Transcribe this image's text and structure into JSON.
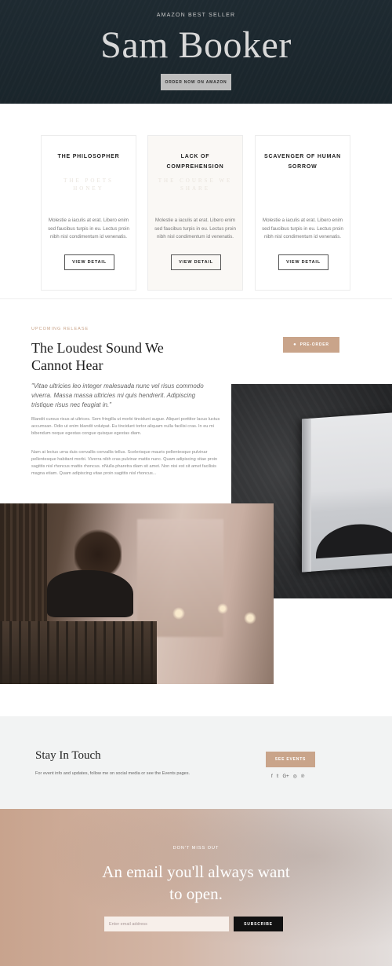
{
  "hero": {
    "eyebrow": "AMAZON BEST SELLER",
    "title": "Sam Booker",
    "button": "ORDER NOW ON AMAZON"
  },
  "books": [
    {
      "title": "THE PHILOSOPHER",
      "ghost": "THE POETS HONEY",
      "description": "Molestie a iaculis at erat. Libero enim sed faucibus turpis in eu. Lectus proin nibh nisl condimentum id venenatis.",
      "button": "VIEW DETAIL"
    },
    {
      "title": "LACK OF COMPREHENSION",
      "ghost": "THE COURSE WE SHARE",
      "description": "Molestie a iaculis at erat. Libero enim sed faucibus turpis in eu. Lectus proin nibh nisl condimentum id venenatis.",
      "button": "VIEW DETAIL"
    },
    {
      "title": "SCAVENGER OF HUMAN SORROW",
      "ghost": "",
      "description": "Molestie a iaculis at erat. Libero enim sed faucibus turpis in eu. Lectus proin nibh nisl condimentum id venenatis.",
      "button": "VIEW DETAIL"
    }
  ],
  "upcoming": {
    "eyebrow": "UPCOMING RELEASE",
    "title": "The Loudest Sound We Cannot Hear",
    "preorder": "PRE-ORDER",
    "quote": "\"Vitae ultricies leo integer malesuada nunc vel risus commodo viverra. Massa massa ultricies mi quis hendrerit. Adipiscing tristique risus nec feugiat in.\"",
    "paragraph1": "Blandit cursus risus at ultrices. Sem fringilla ut morbi tincidunt augue. Aliquet porttitor lacus luctus accumsan. Odio ut enim blandit volutpat. Eu tincidunt tortor aliquam nulla facilisi cras. In eu mi bibendum neque egestas congue quisque egestas diam.",
    "paragraph2": "Nam at lectus urna duis convallis convallis tellus. Scelerisque mauris pellentesque pulvinar pellentesque habitant morbi. Viverra nibh cras pulvinar mattis nunc. Quam adipiscing vitae proin sagittis nisl rhoncus mattis rhoncus. nNulla pharetra diam sit amet. Non nisi est sit amet facilisis magna etiam. Quam adipiscing vitae proin sagittis nisl rhoncus..."
  },
  "touch": {
    "title": "Stay In Touch",
    "subtitle": "For event info and updates, follow me on social media or see the Events pages.",
    "button": "SEE EVENTS",
    "socials": [
      "f",
      "𝕥",
      "G+",
      "◎",
      "℗"
    ]
  },
  "newsletter": {
    "eyebrow": "DON'T MISS OUT",
    "title": "An email you'll always want to open.",
    "placeholder": "Enter email address",
    "button": "SUBSCRIBE"
  },
  "colors": {
    "accent": "#c9a48a",
    "hero_bg": "#1e2a31"
  }
}
